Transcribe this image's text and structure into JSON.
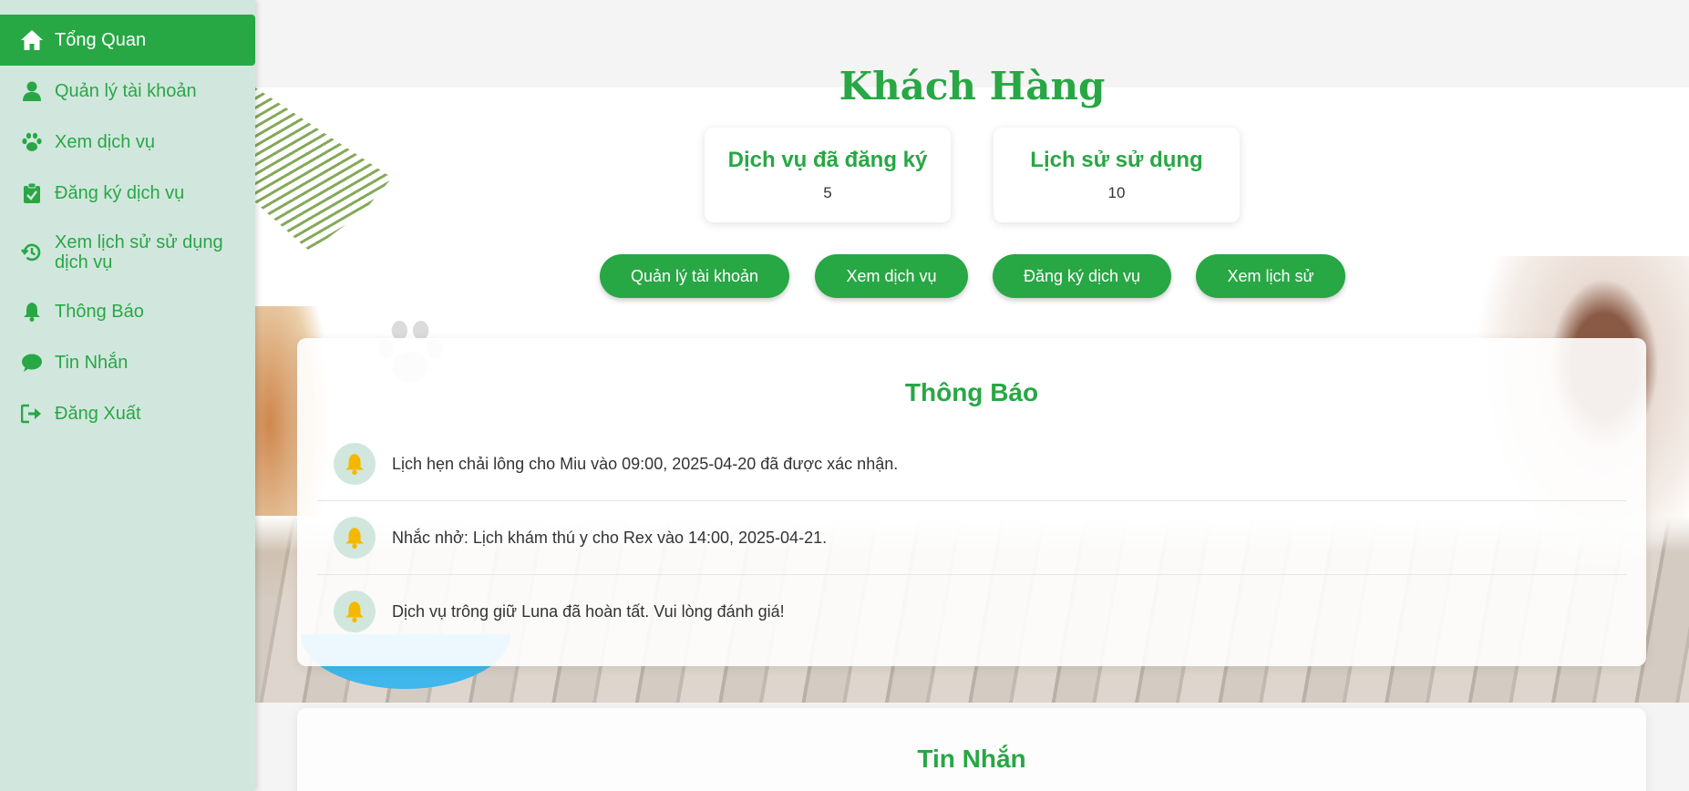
{
  "sidebar": {
    "items": [
      {
        "label": "Tổng Quan",
        "icon": "home-icon"
      },
      {
        "label": "Quản lý tài khoản",
        "icon": "user-icon"
      },
      {
        "label": "Xem dịch vụ",
        "icon": "paw-icon"
      },
      {
        "label": "Đăng ký dịch vụ",
        "icon": "clipboard-check-icon"
      },
      {
        "label": "Xem lịch sử sử dụng dịch vụ",
        "icon": "history-icon"
      },
      {
        "label": "Thông Báo",
        "icon": "bell-icon"
      },
      {
        "label": "Tin Nhắn",
        "icon": "chat-icon"
      },
      {
        "label": "Đăng Xuất",
        "icon": "logout-icon"
      }
    ]
  },
  "main": {
    "title": "Khách Hàng",
    "stats": [
      {
        "title": "Dịch vụ đã đăng ký",
        "value": "5"
      },
      {
        "title": "Lịch sử sử dụng",
        "value": "10"
      }
    ],
    "buttons": [
      "Quản lý tài khoản",
      "Xem dịch vụ",
      "Đăng ký dịch vụ",
      "Xem lịch sử"
    ],
    "notifications": {
      "title": "Thông Báo",
      "items": [
        "Lịch hẹn chải lông cho Miu vào 09:00, 2025-04-20 đã được xác nhận.",
        "Nhắc nhở: Lịch khám thú y cho Rex vào 14:00, 2025-04-21.",
        "Dịch vụ trông giữ Luna đã hoàn tất. Vui lòng đánh giá!"
      ]
    },
    "messages": {
      "title": "Tin Nhắn"
    }
  },
  "colors": {
    "accent": "#28a745",
    "sidebar_bg": "#d1e7dd",
    "bell": "#f5b800"
  }
}
